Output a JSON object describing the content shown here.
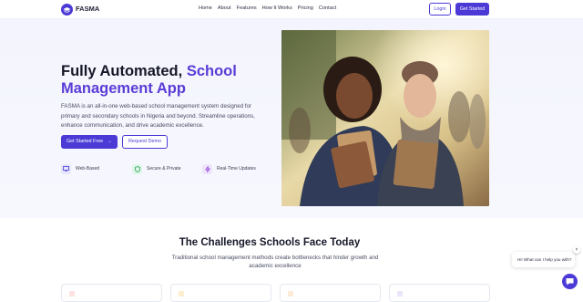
{
  "brand": {
    "name": "FASMA"
  },
  "nav": {
    "items": [
      "Home",
      "About",
      "Features",
      "How It Works",
      "Pricing",
      "Contact"
    ],
    "login": "Login",
    "get_started": "Get Started"
  },
  "hero": {
    "title_part1": "Fully Automated, ",
    "title_accent1": "School",
    "title_accent2": "Management App",
    "description": "FASMA is an all-in-one web-based school management system designed for primary and secondary schools in Nigeria and beyond. Streamline operations, enhance communication, and drive academic excellence.",
    "cta_primary": "Get Started Free",
    "cta_primary_icon": "arrow-right-icon",
    "cta_secondary": "Request Demo",
    "features": [
      {
        "label": "Web-Based",
        "icon": "monitor-icon"
      },
      {
        "label": "Secure & Private",
        "icon": "shield-icon"
      },
      {
        "label": "Real-Time Updates",
        "icon": "lightning-icon"
      }
    ]
  },
  "challenges": {
    "title": "The Challenges Schools Face Today",
    "subtitle": "Traditional school management methods create bottlenecks that hinder growth and academic excellence"
  },
  "chat": {
    "message": "Hi! What can I help you with?",
    "close": "×"
  },
  "colors": {
    "accent": "#4b3ad6",
    "accent_text": "#5b3cd6"
  }
}
